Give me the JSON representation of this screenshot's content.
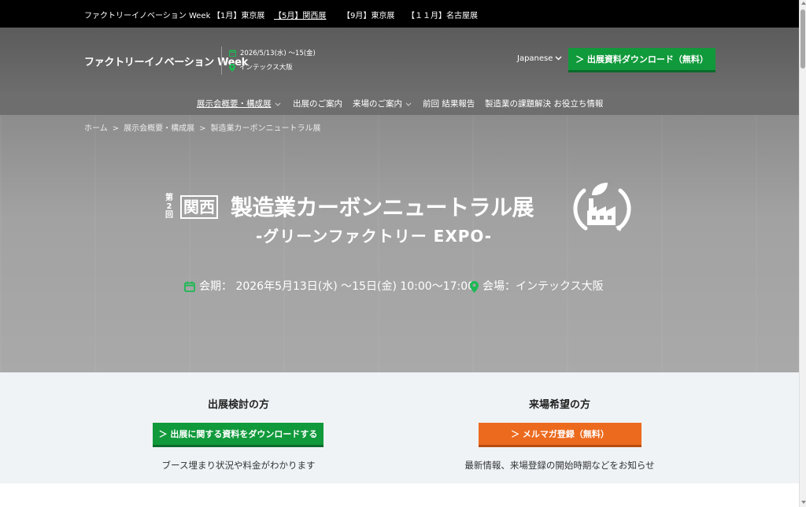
{
  "topbar": {
    "items": [
      {
        "label": "ファクトリーイノベーション Week",
        "active": false
      },
      {
        "label": "【1月】東京展",
        "active": false
      },
      {
        "label": "【5月】関西展",
        "active": true
      },
      {
        "label": "【9月】東京展",
        "active": false
      },
      {
        "label": "【１１月】名古屋展",
        "active": false
      }
    ]
  },
  "header": {
    "logo": "ファクトリーイノベーション Week",
    "date": "2026/5/13(水) ～15(金)",
    "venue": "インテックス大阪",
    "language": "Japanese",
    "download_button": "＞ 出展資料ダウンロード（無料）"
  },
  "nav": {
    "items": [
      {
        "label": "展示会概要・構成展",
        "active": true,
        "dropdown": true
      },
      {
        "label": "出展のご案内",
        "active": false,
        "dropdown": false
      },
      {
        "label": "来場のご案内",
        "active": false,
        "dropdown": true
      },
      {
        "label": "前回 結果報告",
        "active": false,
        "dropdown": false
      },
      {
        "label": "製造業の課題解決 お役立ち情報",
        "active": false,
        "dropdown": false
      }
    ]
  },
  "breadcrumb": {
    "items": [
      "ホーム",
      "展示会概要・構成展",
      "製造業カーボンニュートラル展"
    ],
    "separator": ">"
  },
  "hero": {
    "edition": "第2回",
    "region": "関西",
    "title": "製造業カーボンニュートラル展",
    "subtitle": "-グリーンファクトリー EXPO-",
    "period_label": "会期：",
    "period_value": "2026年5月13日(水) ～15日(金) 10:00～17:00",
    "venue_label": "会場：",
    "venue_value": "インテックス大阪"
  },
  "cta": {
    "exhibitor": {
      "heading": "出展検討の方",
      "button": "＞ 出展に関する資料をダウンロードする",
      "note": "ブース埋まり状況や料金がわかります"
    },
    "visitor": {
      "heading": "来場希望の方",
      "button": "＞ メルマガ登録（無料）",
      "note": "最新情報、来場登録の開始時期などをお知らせ"
    }
  },
  "colors": {
    "accent_green": "#109a3c",
    "accent_orange": "#ec6a1e",
    "icon_green": "#1db954"
  }
}
